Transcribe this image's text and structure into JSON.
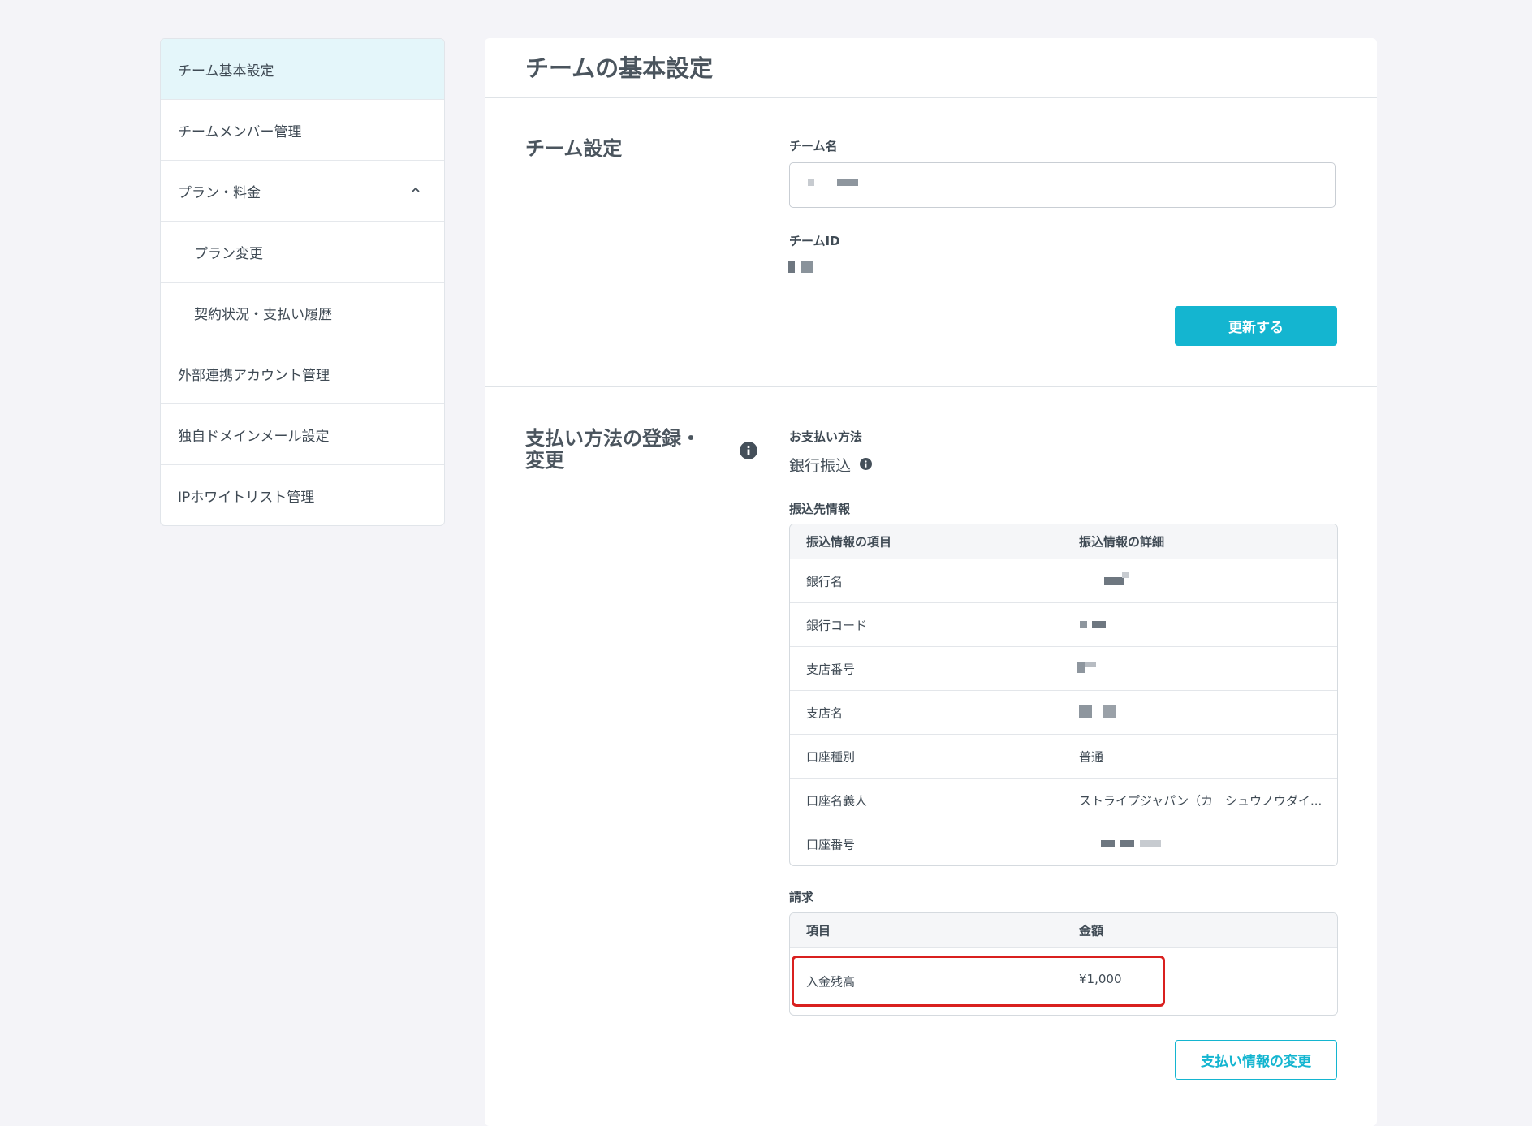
{
  "sidebar": {
    "items": [
      {
        "label": "チーム基本設定"
      },
      {
        "label": "チームメンバー管理"
      },
      {
        "label": "プラン・料金"
      },
      {
        "label": "プラン変更"
      },
      {
        "label": "契約状況・支払い履歴"
      },
      {
        "label": "外部連携アカウント管理"
      },
      {
        "label": "独自ドメインメール設定"
      },
      {
        "label": "IPホワイトリスト管理"
      }
    ]
  },
  "main": {
    "title": "チームの基本設定",
    "team_settings": {
      "title": "チーム設定",
      "team_name_label": "チーム名",
      "team_id_label": "チームID",
      "update_button": "更新する"
    },
    "payment": {
      "title_line1": "支払い方法の登録・",
      "title_line2": "変更",
      "method_label": "お支払い方法",
      "method_value": "銀行振込",
      "transfer_label": "振込先情報",
      "transfer_table": {
        "headers": [
          "振込情報の項目",
          "振込情報の詳細"
        ],
        "rows": [
          {
            "item": "銀行名",
            "detail": ""
          },
          {
            "item": "銀行コード",
            "detail": ""
          },
          {
            "item": "支店番号",
            "detail": ""
          },
          {
            "item": "支店名",
            "detail": ""
          },
          {
            "item": "口座種別",
            "detail": "普通"
          },
          {
            "item": "口座名義人",
            "detail": "ストライプジャパン（カ　シュウノウダイ..."
          },
          {
            "item": "口座番号",
            "detail": ""
          }
        ]
      },
      "billing_label": "請求",
      "billing_table": {
        "headers": [
          "項目",
          "金額"
        ],
        "rows": [
          {
            "item": "入金残高",
            "amount": "¥1,000"
          }
        ]
      },
      "change_button": "支払い情報の変更"
    }
  },
  "colors": {
    "accent": "#14b5d0",
    "highlight": "#d9201f",
    "active_bg": "#e4f6fa"
  }
}
